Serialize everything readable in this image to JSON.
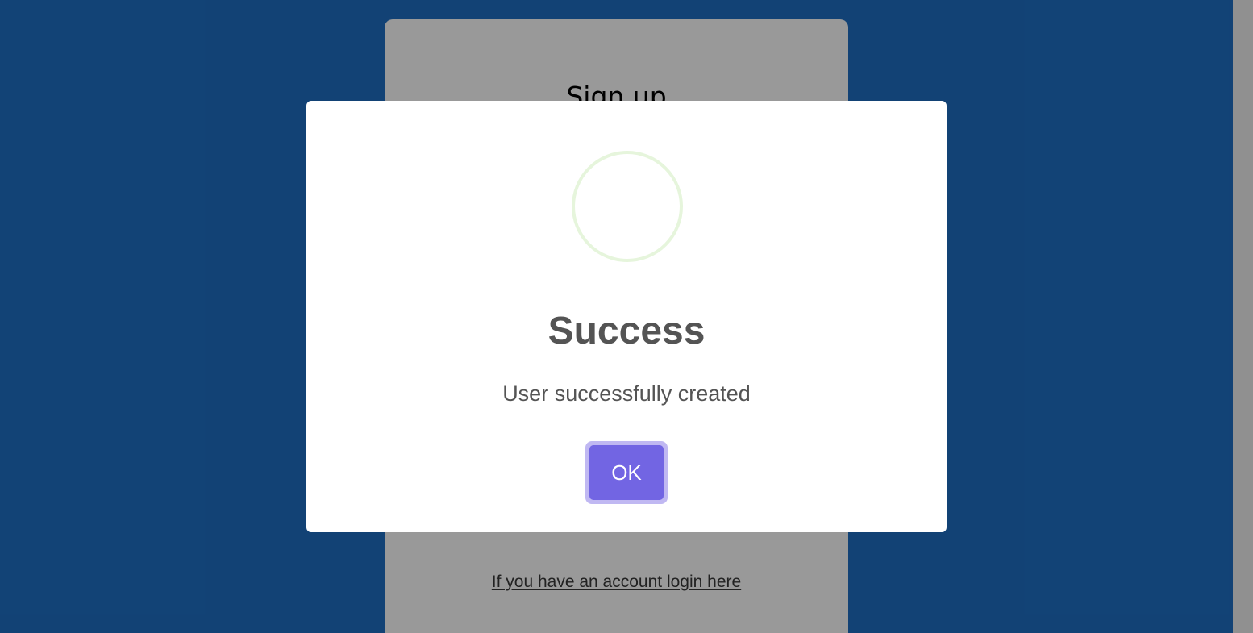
{
  "signup_card": {
    "title": "Sign up",
    "login_link": "If you have an account login here"
  },
  "modal": {
    "icon": "success-ring-icon",
    "title": "Success",
    "message": "User successfully created",
    "ok_label": "OK"
  },
  "colors": {
    "page_background": "#1e6fc4",
    "overlay": "rgba(0,0,0,0.4)",
    "button": "#7265e3",
    "button_focus_ring": "#c0b8f2",
    "success_ring": "#e6f5dc",
    "modal_text": "#545454"
  }
}
